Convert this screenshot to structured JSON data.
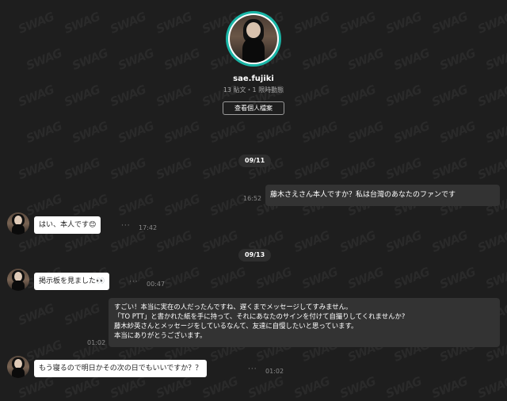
{
  "profile": {
    "username": "sae.fujiki",
    "stats": "13 貼文・1 限時動態",
    "view_profile_label": "查看個人檔案"
  },
  "watermark_text": "SWAG",
  "dates": [
    "09/11",
    "09/13"
  ],
  "messages": {
    "m1": {
      "text": "藤木さえさん本人ですか？私は台灣のあなたのファンです",
      "time": "16:52"
    },
    "m2": {
      "text": "はい、本人です😊",
      "time": "17:42"
    },
    "m3": {
      "text": "掲示板を見ました👀",
      "time": "00:47"
    },
    "m4": {
      "lines": [
        "すごい！本当に実在の人だったんですね、遅くまでメッセージしてすみません。",
        "「TO PTT」と書かれた紙を手に持って、それにあなたのサインを付けて自撮りしてくれませんか?",
        "藤木紗英さんとメッセージをしているなんて、友達に自慢したいと思っています。",
        "本当にありがとうございます。"
      ],
      "time": "01:02"
    },
    "m5": {
      "text": "もう寝るので明日かその次の日でもいいですか？？",
      "time": "01:02"
    }
  },
  "more_options_glyph": "···",
  "colors": {
    "background": "#1e1e1e",
    "avatar_ring": "#19b5a6",
    "outgoing_bubble": "#333333",
    "incoming_bubble": "#ffffff"
  }
}
